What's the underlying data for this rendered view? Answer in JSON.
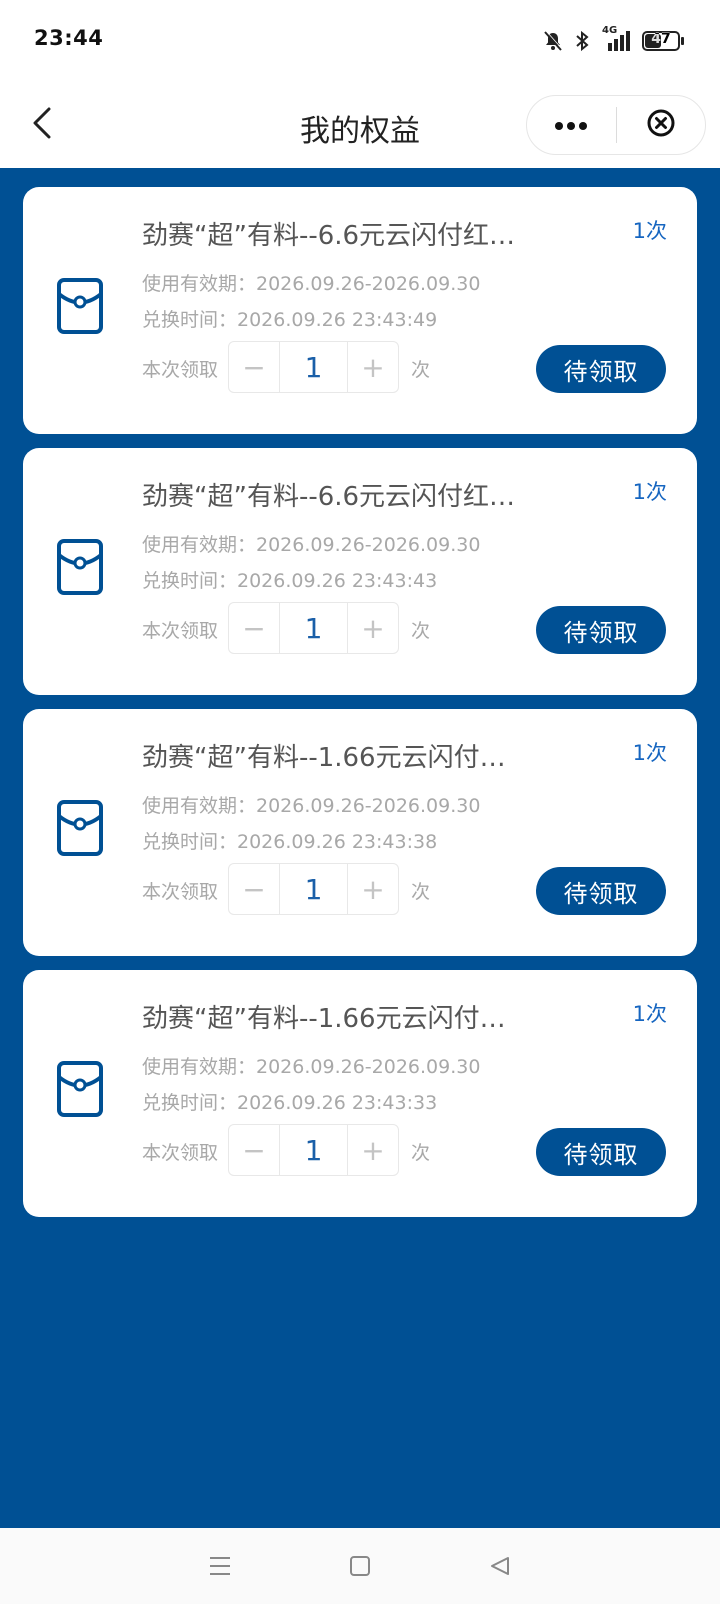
{
  "status_bar": {
    "time": "23:44",
    "network": "4G",
    "battery": "47",
    "battery_level": 0.47,
    "icons": [
      "mute-bell-icon",
      "bluetooth-icon",
      "signal-icon",
      "battery-icon"
    ]
  },
  "nav": {
    "title": "我的权益",
    "back_icon": "chevron-left-icon",
    "more_icon": "more-dots-icon",
    "close_icon": "close-circle-icon"
  },
  "colors": {
    "primary": "#005094",
    "accent_text": "#1565c0"
  },
  "cards": [
    {
      "title": "劲赛“超”有料--6.6元云闪付红…",
      "count": "1次",
      "validity": "使用有效期：2026.09.26-2026.09.30",
      "exchange_time": "兑换时间：2026.09.26 23:43:49",
      "claim_label": "本次领取",
      "quantity": "1",
      "unit": "次",
      "button": "待领取",
      "icon": "red-envelope-icon"
    },
    {
      "title": "劲赛“超”有料--6.6元云闪付红…",
      "count": "1次",
      "validity": "使用有效期：2026.09.26-2026.09.30",
      "exchange_time": "兑换时间：2026.09.26 23:43:43",
      "claim_label": "本次领取",
      "quantity": "1",
      "unit": "次",
      "button": "待领取",
      "icon": "red-envelope-icon"
    },
    {
      "title": "劲赛“超”有料--1.66元云闪付…",
      "count": "1次",
      "validity": "使用有效期：2026.09.26-2026.09.30",
      "exchange_time": "兑换时间：2026.09.26 23:43:38",
      "claim_label": "本次领取",
      "quantity": "1",
      "unit": "次",
      "button": "待领取",
      "icon": "red-envelope-icon"
    },
    {
      "title": "劲赛“超”有料--1.66元云闪付…",
      "count": "1次",
      "validity": "使用有效期：2026.09.26-2026.09.30",
      "exchange_time": "兑换时间：2026.09.26 23:43:33",
      "claim_label": "本次领取",
      "quantity": "1",
      "unit": "次",
      "button": "待领取",
      "icon": "red-envelope-icon"
    }
  ],
  "system_nav": {
    "icons": [
      "menu-icon",
      "home-square-icon",
      "back-triangle-icon"
    ]
  }
}
